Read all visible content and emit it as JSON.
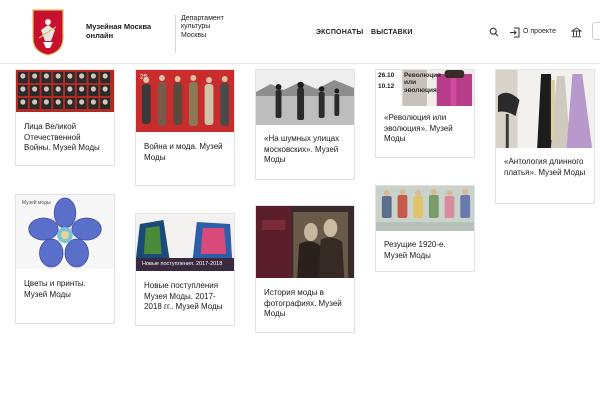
{
  "header": {
    "site_title": "Музейная Москва онлайн",
    "department": "Департамент культуры Москвы",
    "nav": [
      {
        "label": "ЭКСПОНАТЫ"
      },
      {
        "label": "ВЫСТАВКИ"
      }
    ],
    "about_label": "О проекте"
  },
  "cards": [
    {
      "title": "Лица Великой Отечественной Войны. Музей Моды"
    },
    {
      "title": "Война и мода. Музей Моды"
    },
    {
      "title": "«На шумных улицах московских». Музей Моды"
    },
    {
      "title": "«Революция или эволюция». Музей Моды",
      "thumb_text": [
        "26.10",
        "10.12",
        "Революция",
        "или",
        "эволюция"
      ]
    },
    {
      "title": "«Антология длинного платья». Музей Моды"
    },
    {
      "title": "Цветы и принты. Музей Моды",
      "thumb_text": [
        "Музей моды"
      ]
    },
    {
      "title": "Новые поступления Музея Моды. 2017-2018 гг.. Музей Моды",
      "thumb_text": [
        "Новые поступления. 2017-2018"
      ]
    },
    {
      "title": "История моды в фотографиях. Музей Моды"
    },
    {
      "title": "Резущие 1920-е. Музей Моды"
    }
  ]
}
